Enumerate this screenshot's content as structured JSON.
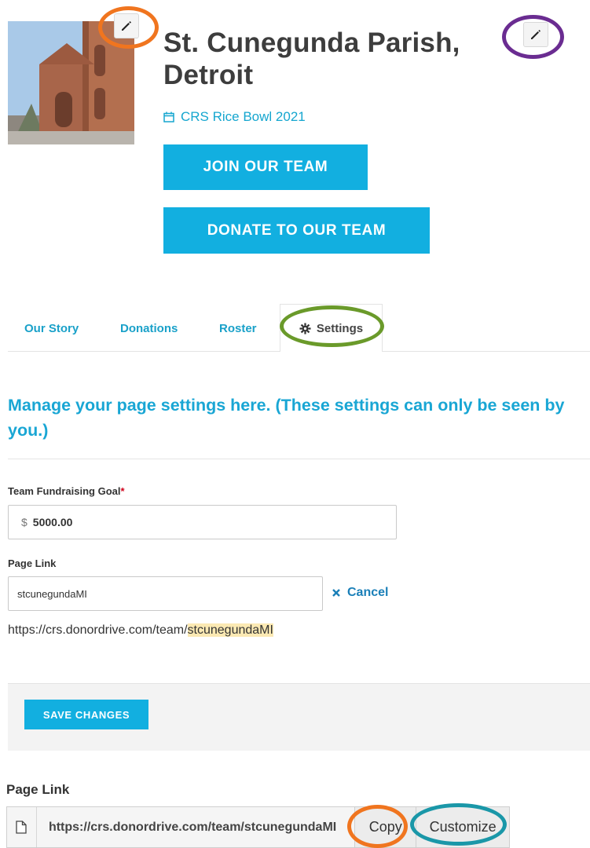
{
  "header": {
    "team_name": "St. Cunegunda Parish, Detroit",
    "event_name": "CRS Rice Bowl 2021",
    "join_button": "JOIN OUR TEAM",
    "donate_button": "DONATE TO OUR TEAM",
    "photo_icon": "pencil-icon",
    "title_icon": "pencil-icon"
  },
  "tabs": {
    "items": [
      "Our Story",
      "Donations",
      "Roster"
    ],
    "active": "Settings",
    "active_icon": "gear-icon"
  },
  "settings": {
    "heading": "Manage your page settings here. (These settings can only be seen by you.)",
    "goal_label": "Team Fundraising Goal",
    "goal_required_mark": "*",
    "goal_currency": "$",
    "goal_value": "5000.00",
    "page_link_label": "Page Link",
    "page_link_value": "stcunegundaMI",
    "cancel_label": "Cancel",
    "url_prefix": "https://crs.donordrive.com/team/",
    "url_slug": "stcunegundaMI",
    "save_button": "SAVE CHANGES"
  },
  "page_link": {
    "label": "Page Link",
    "url": "https://crs.donordrive.com/team/stcunegundaMI",
    "copy_button": "Copy",
    "customize_button": "Customize",
    "doc_icon": "document-icon"
  },
  "colors": {
    "accent": "#12afe0",
    "link": "#1aa1c9",
    "ring_orange": "#f0751f",
    "ring_purple": "#6a2c91",
    "ring_green": "#6a9a2a",
    "ring_teal": "#1a97a8"
  }
}
